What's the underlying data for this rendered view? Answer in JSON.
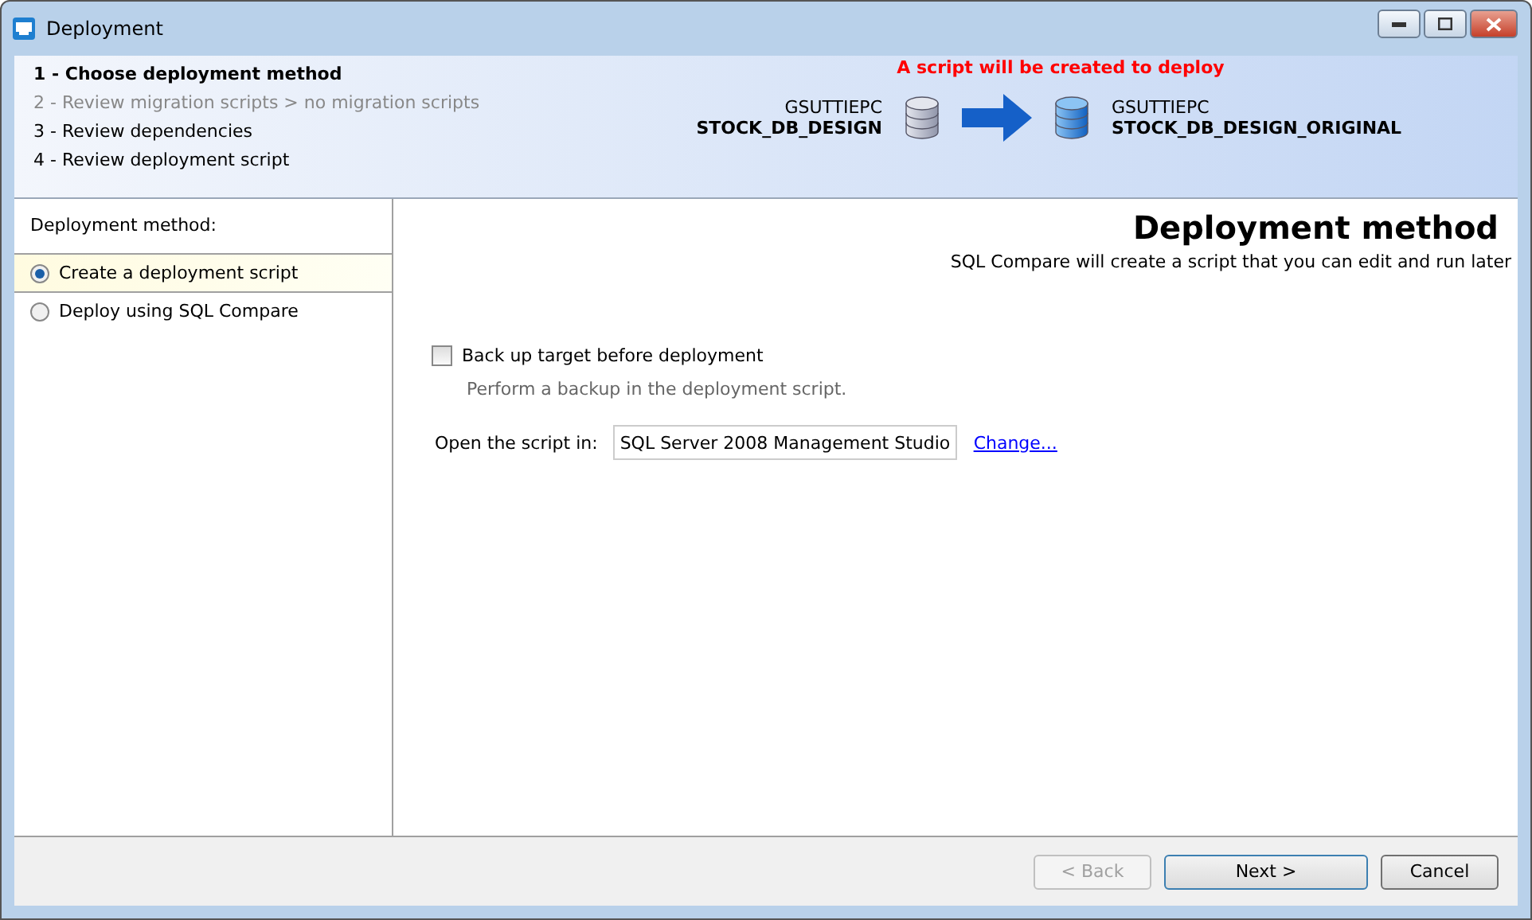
{
  "window": {
    "title": "Deployment"
  },
  "steps": [
    {
      "label": "1 - Choose deployment method",
      "selected": true,
      "disabled": false
    },
    {
      "label": "2 - Review migration scripts > no migration scripts",
      "selected": false,
      "disabled": true
    },
    {
      "label": "3 - Review dependencies",
      "selected": false,
      "disabled": false
    },
    {
      "label": "4 - Review deployment script",
      "selected": false,
      "disabled": false
    }
  ],
  "notice": "A script will be created to deploy",
  "source": {
    "server": "GSUTTIEPC",
    "database": "STOCK_DB_DESIGN"
  },
  "target": {
    "server": "GSUTTIEPC",
    "database": "STOCK_DB_DESIGN_ORIGINAL"
  },
  "methods": {
    "heading": "Deployment method:",
    "options": [
      {
        "label": "Create a deployment script",
        "selected": true
      },
      {
        "label": "Deploy using SQL Compare",
        "selected": false
      }
    ]
  },
  "content": {
    "title": "Deployment method",
    "subtitle": "SQL Compare will create a script that you can edit and run later",
    "backup": {
      "label": "Back up target before deployment",
      "checked": false,
      "hint": "Perform a backup in the deployment script."
    },
    "open_in": {
      "label": "Open the script in:",
      "value": "SQL Server 2008 Management Studio",
      "link": "Change..."
    }
  },
  "buttons": [
    {
      "label": "< Back",
      "disabled": true,
      "default": false
    },
    {
      "label": "Next >",
      "disabled": false,
      "default": true
    },
    {
      "label": "Cancel",
      "disabled": false,
      "default": false
    }
  ]
}
